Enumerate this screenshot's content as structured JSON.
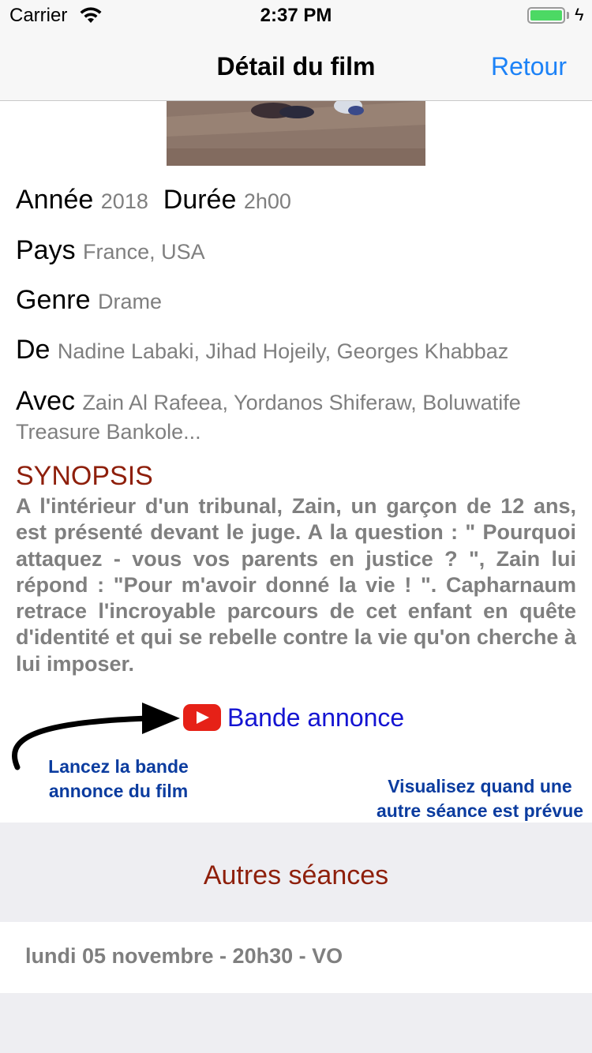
{
  "status_bar": {
    "carrier": "Carrier",
    "time": "2:37 PM",
    "battery_color": "#4cd964"
  },
  "navbar": {
    "title": "Détail du film",
    "back_label": "Retour"
  },
  "details": {
    "annee_label": "Année",
    "annee_value": "2018",
    "duree_label": "Durée",
    "duree_value": "2h00",
    "pays_label": "Pays",
    "pays_value": "France, USA",
    "genre_label": "Genre",
    "genre_value": "Drame",
    "de_label": "De",
    "de_value": "Nadine Labaki, Jihad Hojeily, Georges Khabbaz",
    "avec_label": "Avec",
    "avec_value_line1": "Zain Al Rafeea, Yordanos Shiferaw, Boluwatife",
    "avec_value_line2": "Treasure Bankole..."
  },
  "synopsis": {
    "title": "SYNOPSIS",
    "text": "A l'intérieur d'un tribunal, Zain, un garçon de 12 ans, est présenté devant le juge. A la question : \" Pourquoi attaquez - vous vos parents en justice ? \", Zain lui répond : \"Pour m'avoir donné la vie ! \". Capharnaum retrace l'incroyable parcours de cet enfant en quête d'identité et qui se rebelle contre la vie qu'on cherche à lui imposer.",
    "title_color": "#8e1f0b"
  },
  "trailer": {
    "label": "Bande annonce",
    "icon": "youtube-play-icon",
    "color": "#1414d2"
  },
  "annotations": {
    "trailer_note": "Lancez la bande annonce du film",
    "sessions_note": "Visualisez quand une autre séance est prévue pour ce film"
  },
  "sessions": {
    "header": "Autres séances",
    "items": [
      "lundi 05 novembre - 20h30 - VO"
    ]
  }
}
